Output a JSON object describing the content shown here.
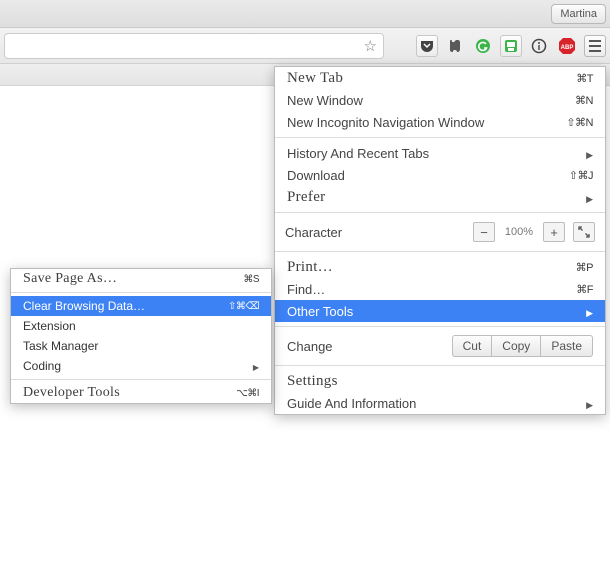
{
  "titlebar": {
    "user_button": "Martina"
  },
  "toolbar": {
    "icons": {
      "star": "star-icon",
      "pocket": "pocket-icon",
      "evernote": "evernote-icon",
      "grammarly": "grammarly-icon",
      "print": "print-icon",
      "info": "info-icon",
      "abp": "abp-icon",
      "menu": "hamburger-icon"
    }
  },
  "menu": {
    "new_tab": {
      "label": "New Tab",
      "shortcut": "⌘T"
    },
    "new_window": {
      "label": "New Window",
      "shortcut": "⌘N"
    },
    "incognito": {
      "label": "New Incognito Navigation Window",
      "shortcut": "⇧⌘N"
    },
    "history": {
      "label": "History And Recent Tabs"
    },
    "download": {
      "label": "Download",
      "shortcut": "⇧⌘J"
    },
    "prefer": {
      "label": "Prefer"
    },
    "character": {
      "label": "Character"
    },
    "zoom": {
      "minus": "−",
      "value": "100%",
      "plus": "+"
    },
    "print": {
      "label": "Print…",
      "shortcut": "⌘P"
    },
    "find": {
      "label": "Find…",
      "shortcut": "⌘F"
    },
    "other_tools": {
      "label": "Other Tools"
    },
    "change": {
      "label": "Change"
    },
    "edit": {
      "cut": "Cut",
      "copy": "Copy",
      "paste": "Paste"
    },
    "settings": {
      "label": "Settings"
    },
    "guide": {
      "label": "Guide And Information"
    }
  },
  "submenu": {
    "save_as": {
      "label": "Save Page As…",
      "shortcut": "⌘S"
    },
    "clear_data": {
      "label": "Clear Browsing Data…",
      "shortcut": "⇧⌘⌫"
    },
    "extension": {
      "label": "Extension"
    },
    "task_manager": {
      "label": "Task Manager"
    },
    "coding": {
      "label": "Coding"
    },
    "dev_tools": {
      "label": "Developer Tools",
      "shortcut": "⌥⌘I"
    }
  }
}
